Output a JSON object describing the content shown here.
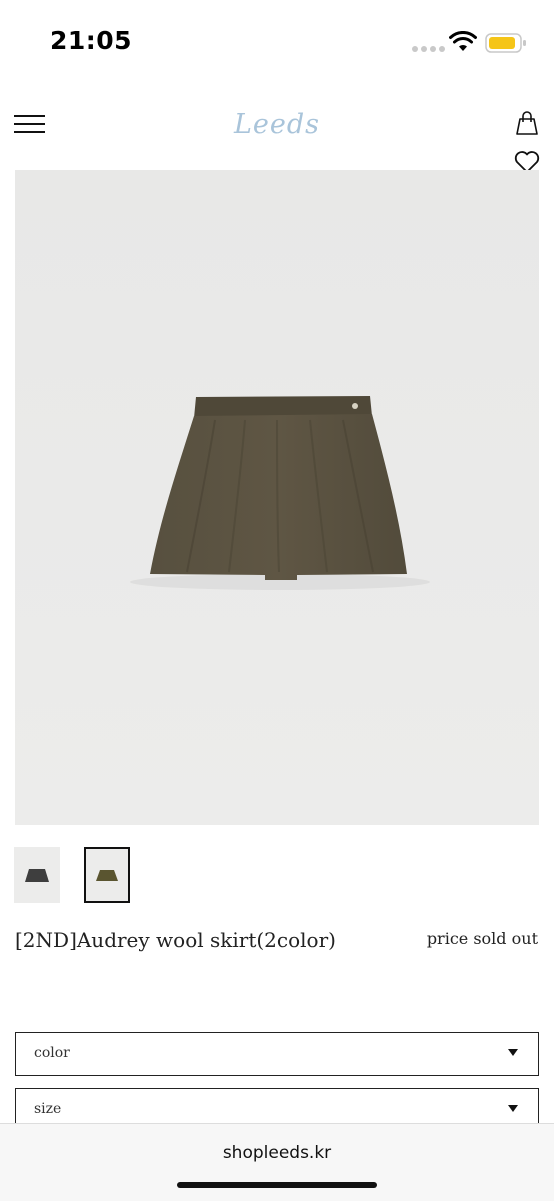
{
  "status_bar": {
    "time": "21:05",
    "icons": [
      "signal-dots-icon",
      "wifi-icon",
      "battery-icon"
    ],
    "battery_color": "#f5c518"
  },
  "header": {
    "logo_text": "Leeds",
    "logo_color": "#a9c4da",
    "icons": [
      "hamburger-menu-icon",
      "shopping-bag-icon",
      "heart-icon"
    ]
  },
  "product": {
    "title": "[2ND]Audrey wool skirt(2color)",
    "price": "price sold out",
    "image_alt_icon": "skirt-image",
    "skirt_color": "#5c5240",
    "thumbnails": [
      {
        "color": "#3e3e3e",
        "selected": false
      },
      {
        "color": "#5a5530",
        "selected": true
      }
    ]
  },
  "options": {
    "color_label": "color",
    "size_label": "size"
  },
  "browser": {
    "url": "shopleeds.kr"
  }
}
